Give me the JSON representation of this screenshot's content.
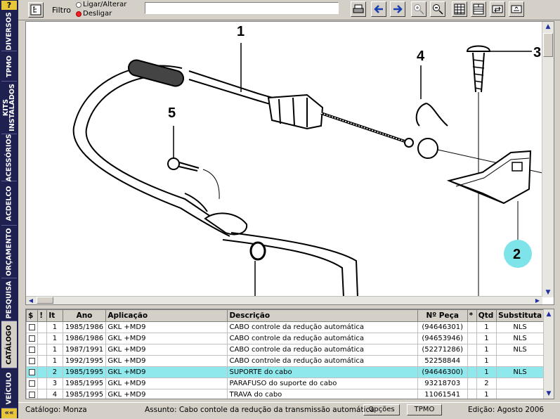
{
  "sidebar": {
    "help": "?",
    "tabs": [
      "DIVERSOS",
      "TPMO",
      "KITS INSTALADOS",
      "ACESSÓRIOS",
      "ACDELCO",
      "ORÇAMENTO",
      "PESQUISA",
      "CATÁLOGO",
      "VEÍCULO"
    ],
    "active": "CATÁLOGO",
    "collapse": "««"
  },
  "toolbar": {
    "filter_label": "Filtro",
    "radio_on_change": "Ligar/Alterar",
    "radio_off": "Desligar",
    "search_value": ""
  },
  "diagram": {
    "callouts": [
      "1",
      "2",
      "3",
      "4",
      "5"
    ],
    "highlight_color": "#7fe3ea"
  },
  "table": {
    "headers": [
      "$",
      "!",
      "It",
      "Ano",
      "Aplicação",
      "Descrição",
      "Nº Peça",
      "*",
      "Qtd",
      "Substituta"
    ],
    "rows": [
      {
        "it": "1",
        "ano": "1985/1986",
        "aplic": "GKL +MD9",
        "desc": "CABO controle da redução automática",
        "peca": "(94646301)",
        "qtd": "1",
        "subst": "NLS"
      },
      {
        "it": "1",
        "ano": "1986/1986",
        "aplic": "GKL +MD9",
        "desc": "CABO controle da redução automática",
        "peca": "(94653946)",
        "qtd": "1",
        "subst": "NLS"
      },
      {
        "it": "1",
        "ano": "1987/1991",
        "aplic": "GKL +MD9",
        "desc": "CABO controle da redução automática",
        "peca": "(52271286)",
        "qtd": "1",
        "subst": "NLS"
      },
      {
        "it": "1",
        "ano": "1992/1995",
        "aplic": "GKL +MD9",
        "desc": "CABO controle da redução automática",
        "peca": "52258844",
        "qtd": "1",
        "subst": ""
      },
      {
        "it": "2",
        "ano": "1985/1995",
        "aplic": "GKL +MD9",
        "desc": "SUPORTE do cabo",
        "peca": "(94646300)",
        "qtd": "1",
        "subst": "NLS"
      },
      {
        "it": "3",
        "ano": "1985/1995",
        "aplic": "GKL +MD9",
        "desc": "PARAFUSO do suporte do cabo",
        "peca": "93218703",
        "qtd": "2",
        "subst": ""
      },
      {
        "it": "4",
        "ano": "1985/1995",
        "aplic": "GKL +MD9",
        "desc": "TRAVA do cabo",
        "peca": "11061541",
        "qtd": "1",
        "subst": ""
      }
    ],
    "selected_index": 4
  },
  "status": {
    "catalog": "Catálogo: Monza",
    "subject": "Assunto: Cabo contole da redução da transmissão automática",
    "options_btn": "Opções",
    "tpmo_btn": "TPMO",
    "edition": "Edição: Agosto 2006"
  }
}
